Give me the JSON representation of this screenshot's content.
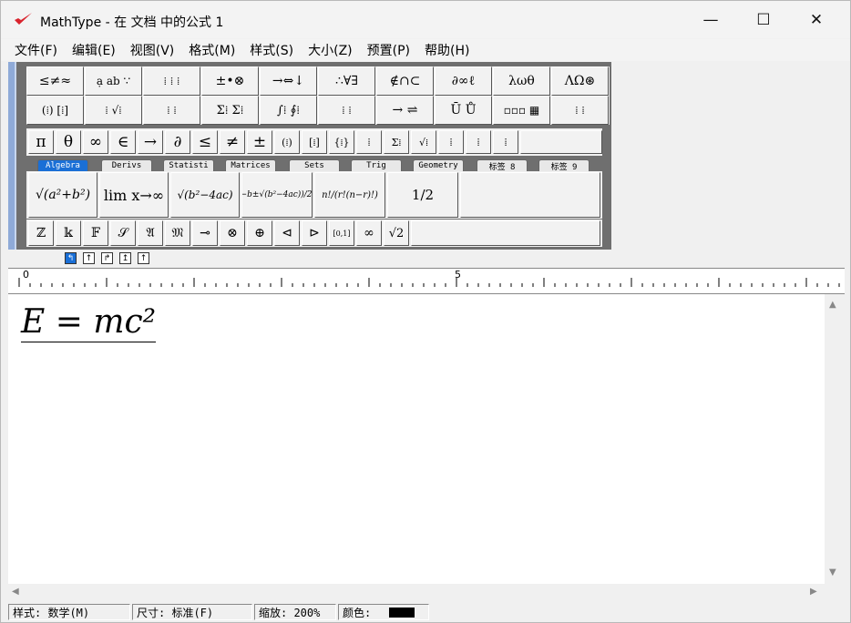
{
  "window": {
    "title": "MathType - 在 文档 中的公式 1",
    "minimize": "—",
    "maximize": "☐",
    "close": "✕"
  },
  "menu": [
    "文件(F)",
    "编辑(E)",
    "视图(V)",
    "格式(M)",
    "样式(S)",
    "大小(Z)",
    "预置(P)",
    "帮助(H)"
  ],
  "palette_row1": [
    "≤≠≈",
    "ạ ab ∵",
    "⁞ ⁞ ⁞",
    "±•⊗",
    "→⇔↓",
    "∴∀∃",
    "∉∩⊂",
    "∂∞ℓ",
    "λωθ",
    "ΛΩ⊛"
  ],
  "palette_row2": [
    "(⁞) [⁞]",
    "⁞ √⁞",
    "⁞ ⁞",
    "Σ⁞ Σ⁞",
    "∫⁞ ∮⁞",
    "⁞ ⁞",
    "→ ⇌",
    "Ū Ů",
    "▫▫▫ ▦",
    "⁞ ⁞"
  ],
  "small_row": [
    "π",
    "θ",
    "∞",
    "∈",
    "→",
    "∂",
    "≤",
    "≠",
    "±",
    "(⁞)",
    "[⁞]",
    "{⁞}",
    "⁞",
    "Σ⁞",
    "√⁞",
    "⁞",
    "⁞",
    "⁞"
  ],
  "tabs": [
    "Algebra",
    "Derivs",
    "Statisti",
    "Matrices",
    "Sets",
    "Trig",
    "Geometry",
    "标签 8",
    "标签 9"
  ],
  "large_row": [
    "√(a²+b²)",
    "lim x→∞",
    "√(b²−4ac)",
    "(−b±√(b²−4ac))/2a",
    "n!/(r!(n−r)!)",
    "1/2"
  ],
  "bottom_row": [
    "ℤ",
    "𝕜",
    "𝔽",
    "𝒮",
    "𝔄",
    "𝔐",
    "⊸",
    "⊗",
    "⊕",
    "⊲",
    "⊳",
    "[0,1]",
    "∞",
    "√2"
  ],
  "nudge": [
    "↰",
    "↑",
    "↱",
    "↥",
    "↑"
  ],
  "ruler": {
    "mark0": "0",
    "mark5": "5"
  },
  "equation": "E = mc²",
  "status": {
    "style": "样式: 数学(M)",
    "size": "尺寸: 标准(F)",
    "zoom": "缩放: 200%",
    "color": "颜色:"
  },
  "colors": {
    "accent": "#1a6fd6",
    "toolbar_side": "#8faad8",
    "logo": "#d9232d"
  }
}
